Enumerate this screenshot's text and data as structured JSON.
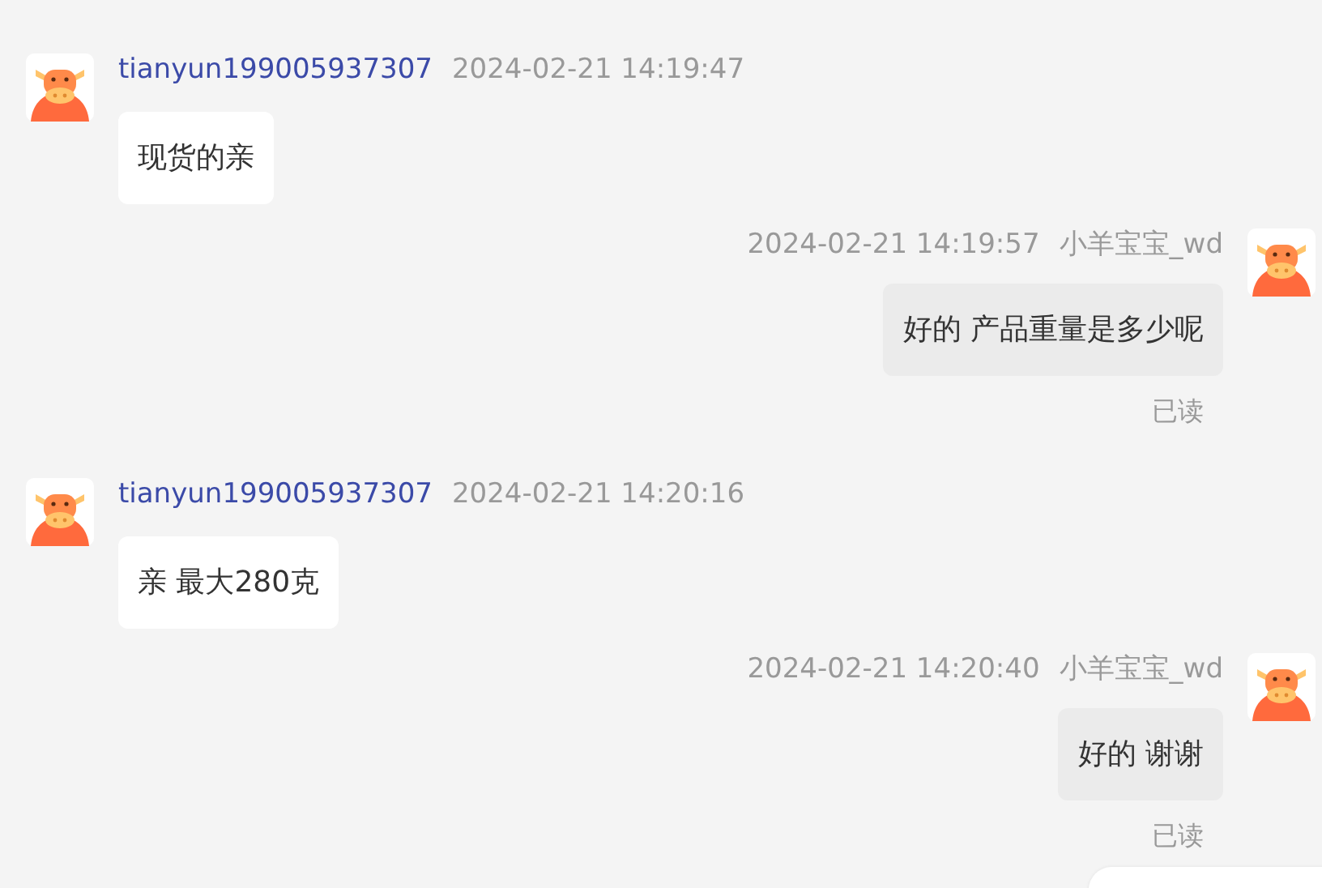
{
  "messages": [
    {
      "kind": "incoming",
      "sender": "tianyun199005937307",
      "time": "2024-02-21 14:19:47",
      "text": "现货的亲"
    },
    {
      "kind": "outgoing",
      "sender": "小羊宝宝_wd",
      "time": "2024-02-21 14:19:57",
      "text": "好的 产品重量是多少呢",
      "status": "已读"
    },
    {
      "kind": "incoming",
      "sender": "tianyun199005937307",
      "time": "2024-02-21 14:20:16",
      "text": "亲 最大280克"
    },
    {
      "kind": "outgoing",
      "sender": "小羊宝宝_wd",
      "time": "2024-02-21 14:20:40",
      "text": "好的 谢谢",
      "status": "已读"
    }
  ]
}
